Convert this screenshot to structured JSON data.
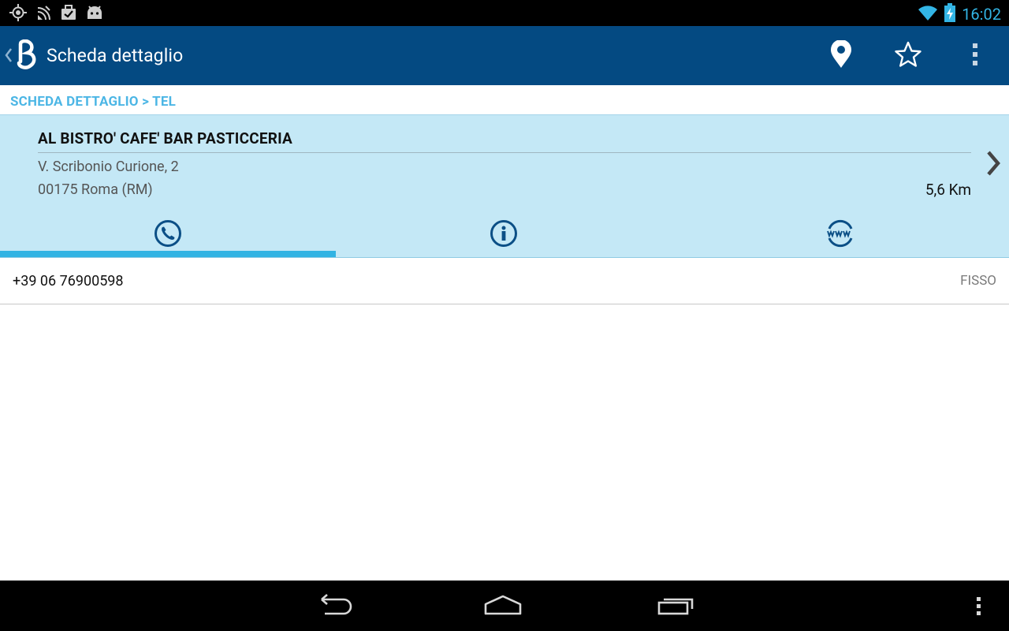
{
  "status_bar": {
    "time": "16:02",
    "icons": [
      "gps-icon",
      "signal-icon",
      "briefcase-check-icon",
      "android-icon",
      "wifi-icon",
      "battery-charging-icon"
    ]
  },
  "action_bar": {
    "title": "Scheda dettaglio",
    "actions": [
      "location-pin-icon",
      "star-icon",
      "overflow-menu-icon"
    ],
    "color": "#044a82"
  },
  "breadcrumb": "SCHEDA DETTAGLIO > TEL",
  "business": {
    "name": "AL BISTRO' CAFE' BAR PASTICCERIA",
    "address_line1": "V. Scribonio Curione, 2",
    "address_line2": "00175 Roma (RM)",
    "distance": "5,6 Km"
  },
  "tabs": [
    {
      "icon": "phone-icon",
      "selected": true
    },
    {
      "icon": "info-icon",
      "selected": false
    },
    {
      "icon": "www-icon",
      "selected": false
    }
  ],
  "phones": [
    {
      "number": "+39 06 76900598",
      "type": "FISSO"
    }
  ],
  "colors": {
    "accent": "#33b5e5",
    "card_bg": "#c4e8f6",
    "icon_dark_blue": "#0b4f86"
  }
}
